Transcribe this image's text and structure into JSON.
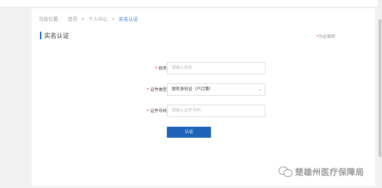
{
  "breadcrumb": {
    "label": "当前位置:",
    "home": "首页",
    "sep1": ">",
    "center": "个人中心",
    "sep2": ">",
    "current": "实名认证"
  },
  "section": {
    "title": "实名认证",
    "required_note_star": "*",
    "required_note": "为必填项"
  },
  "form": {
    "name": {
      "star": "*",
      "label": "姓名",
      "placeholder": "请输入姓名"
    },
    "id_type": {
      "star": "*",
      "label": "证件类型",
      "value": "居民身份证（户口簿）"
    },
    "id_number": {
      "star": "*",
      "label": "证件号码",
      "placeholder": "请输入证件号码"
    },
    "submit_label": "认证"
  },
  "watermark": {
    "text": "楚雄州医疗保障局"
  },
  "colors": {
    "accent": "#1e63b8",
    "breadcrumb_current": "#3a7bd5",
    "required": "#e23"
  },
  "icons": {
    "select_chevron": "chevron-down-icon",
    "watermark_logo": "wechat-icon"
  }
}
